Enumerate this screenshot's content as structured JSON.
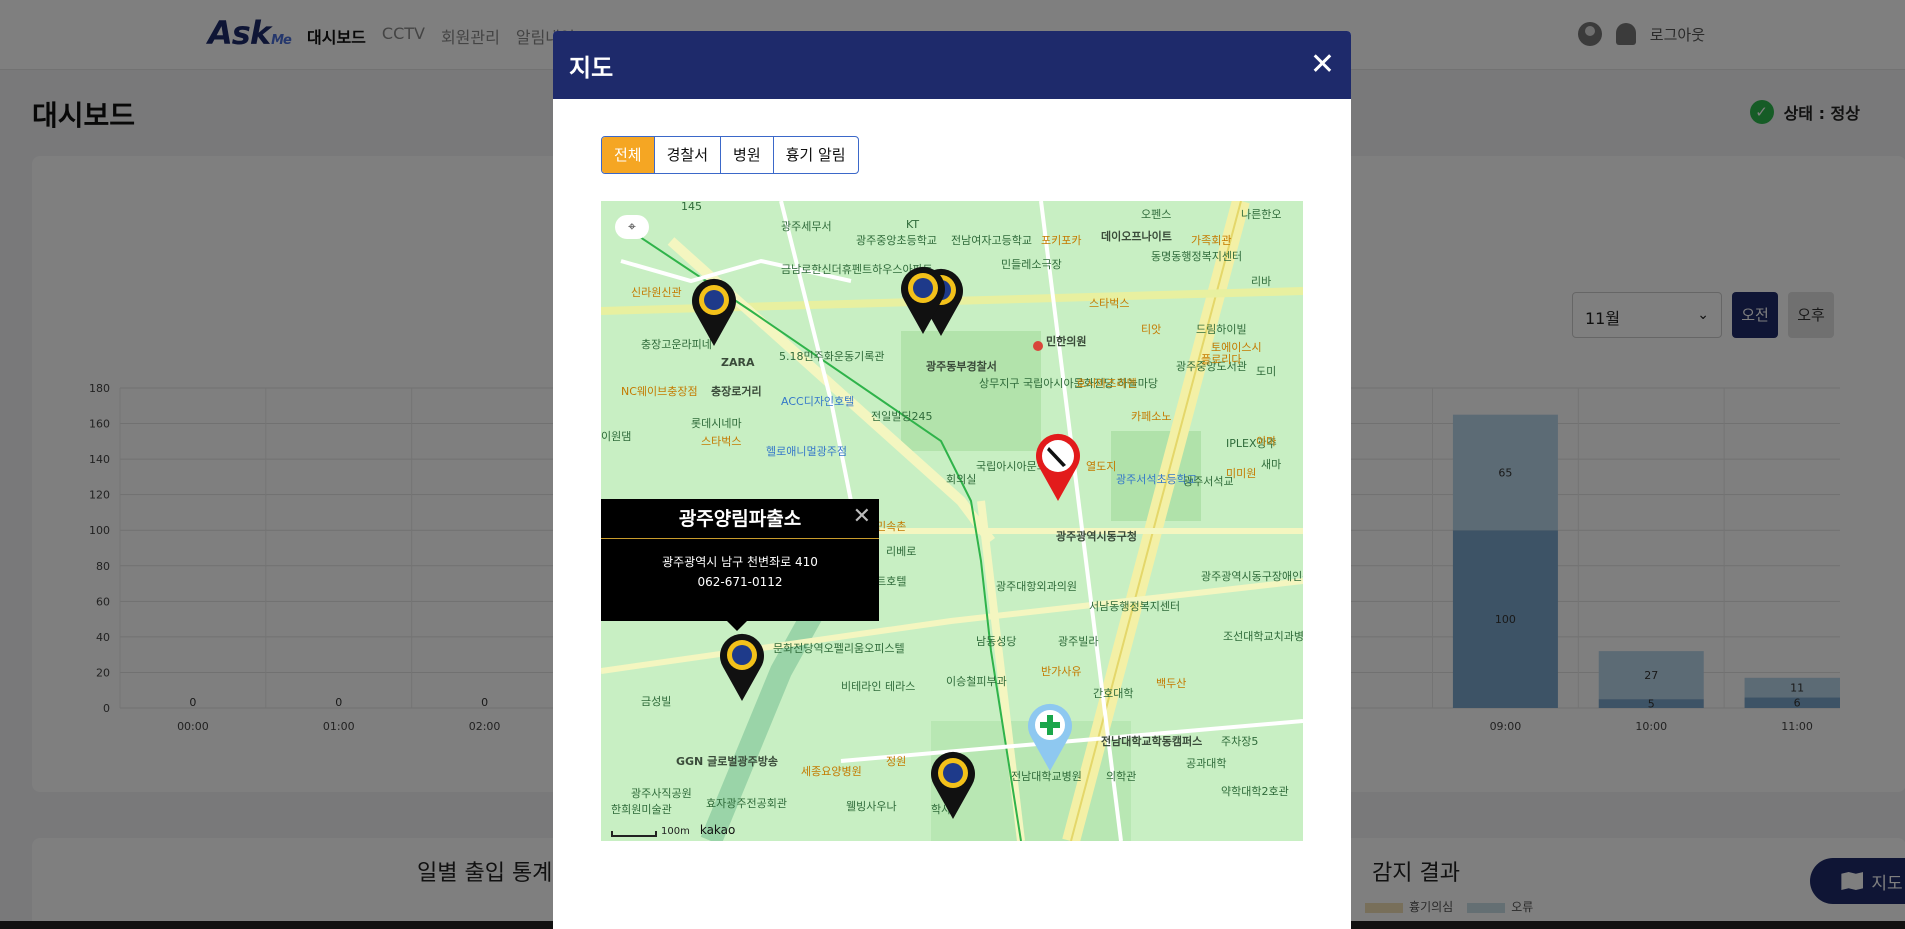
{
  "nav": {
    "logo": "Ask",
    "logo_sub": "Me",
    "links": [
      "대시보드",
      "CCTV",
      "회원관리",
      "알림내역"
    ],
    "logout": "로그아웃"
  },
  "page": {
    "title": "대시보드",
    "status": "상태 : 정상"
  },
  "filters": {
    "month": "11월",
    "am": "오전",
    "pm": "오후"
  },
  "chart_data": {
    "type": "bar",
    "categories": [
      "00:00",
      "01:00",
      "02:00",
      "09:00",
      "10:00",
      "11:00"
    ],
    "series": [
      {
        "values": [
          0,
          0,
          0,
          100,
          5,
          6
        ]
      },
      {
        "values": [
          0,
          0,
          0,
          65,
          27,
          11
        ]
      }
    ],
    "ylim": [
      0,
      180
    ],
    "yticks": [
      0,
      20,
      40,
      60,
      80,
      100,
      120,
      140,
      160,
      180
    ],
    "colors": [
      "#7aa6cc",
      "#b9d6ea"
    ]
  },
  "bottom": {
    "daily_title": "일별 출입 통계",
    "detect_title": "감지 결과",
    "legend": [
      "흉기의심",
      "오류"
    ],
    "legend_colors": [
      "#f1dfb5",
      "#c9dfe6"
    ],
    "legend_prefix": "기"
  },
  "map_fab": "지도",
  "modal": {
    "title": "지도",
    "close": "✕",
    "tabs": [
      "전체",
      "경찰서",
      "병원",
      "흉기 알림"
    ],
    "popup": {
      "title": "광주양림파출소",
      "address": "광주광역시 남구 천변좌로 410",
      "tel": "062-671-0112",
      "close": "✕"
    },
    "map_labels": [
      "145",
      "광주세무서",
      "KT",
      "오펜스",
      "나른한오",
      "광주중앙초등학교",
      "전남여자고등학교",
      "포키포카",
      "데이오프나이트",
      "가족회관",
      "민들레소극장",
      "동명동행정복지센터",
      "리바",
      "금남로한신더휴펜트하우스아파트",
      "광주동부경찰서",
      "상무지구 국립아시아문화전당 하늘마당",
      "광주중앙도서관",
      "민한의원",
      "스타벅스",
      "티앗",
      "드림하이빌",
      "토에이스시",
      "ZARA",
      "5.18민주화운동기록관",
      "충장로거리",
      "ACC디자인호텔",
      "롯데시네마",
      "전일빌딩245",
      "헬로애니멀광주점",
      "회의실",
      "국립아시아문화전당",
      "광주서석초등학교",
      "광주광역시동구청",
      "광주광역시동구장애인복지센터",
      "광주대항외과의원",
      "서남동행정복지센터",
      "조선대학교치과병원",
      "광주빌라",
      "반가사유",
      "이승철피부과",
      "남동성당",
      "간호대학",
      "전남대학교학동캠퍼스",
      "의학관",
      "전남대학교병원",
      "주차장5",
      "공과대학",
      "약학대학2호관",
      "백두산",
      "문화전당역오펠리움오피스텔",
      "비테라인 테라스",
      "세종요양병원",
      "웰빙사우나",
      "학사",
      "금성빌",
      "GGN 글로벌광주방송",
      "광주사직공원",
      "효자광주전공회관",
      "한희원미술관",
      "정원",
      "충장고운라피네",
      "신라원신관",
      "NC웨이브충장점",
      "이원댐",
      "스타벅스",
      "민속촌",
      "리베로",
      "반트호텔",
      "IPLEX광주",
      "광주서석교",
      "미미원",
      "열도지",
      "카페소노",
      "호시마즈라멘",
      "플로리다",
      "도미",
      "이마",
      "새마"
    ],
    "scale": "100m",
    "provider": "kakao"
  }
}
